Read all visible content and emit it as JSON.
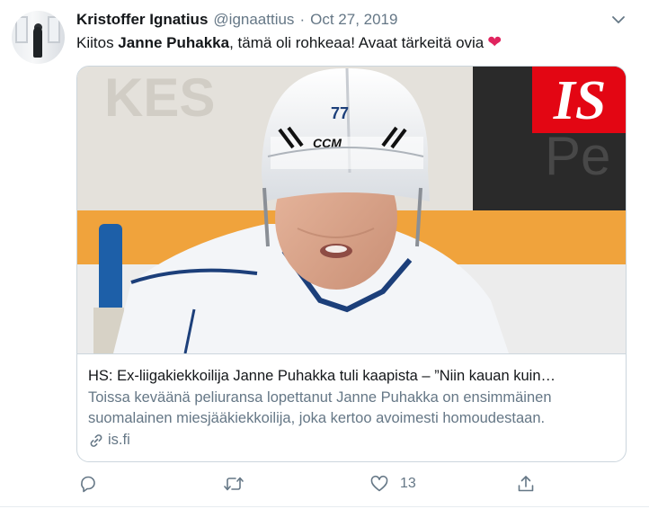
{
  "tweet": {
    "author_name": "Kristoffer Ignatius",
    "author_handle": "@ignaattius",
    "separator": "·",
    "date": "Oct 27, 2019",
    "text_before": "Kiitos ",
    "text_bold": "Janne Puhakka",
    "text_after": ", tämä oli rohkeaa! Avaat tärkeitä ovia",
    "emoji": "❤"
  },
  "card": {
    "badge": "IS",
    "jersey_number": "77",
    "helmet_brand": "CCM",
    "backdrop_text_left": "KES",
    "backdrop_text_right": "Pe",
    "title": "HS: Ex-liigakiekkoilija Janne Puhakka tuli kaapista – ”Niin kauan kuin…",
    "description_line1": "Toissa keväänä peliuransa lopettanut Janne Puhakka on ensimmäinen",
    "description_line2": "suomalainen miesjääkiekkoilija, joka kertoo avoimesti homoudestaan.",
    "domain": "is.fi"
  },
  "actions": {
    "reply_icon": "reply-icon",
    "retweet_icon": "retweet-icon",
    "like_icon": "like-icon",
    "like_count": "13",
    "share_icon": "share-icon"
  },
  "colors": {
    "text_primary": "#14171a",
    "text_secondary": "#657786",
    "heart": "#e0245e",
    "badge_red": "#e30613",
    "border": "#ccd6dd",
    "rink_orange": "#f0a33c"
  }
}
